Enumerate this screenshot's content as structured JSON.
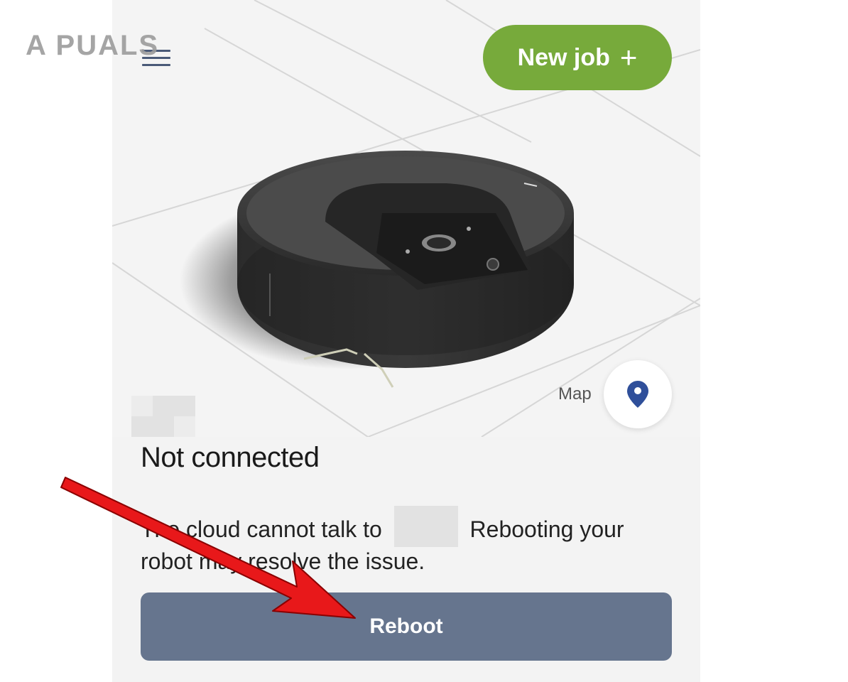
{
  "watermark": {
    "text": "A   PUALS"
  },
  "header": {
    "menu_icon": "hamburger-menu-icon",
    "new_job_label": "New job",
    "new_job_icon": "plus-icon"
  },
  "map": {
    "label": "Map",
    "icon": "location-pin-icon"
  },
  "status": {
    "title": "Not connected",
    "message_part1": "The cloud cannot talk to",
    "message_part2": "Rebooting your robot may resolve the issue."
  },
  "actions": {
    "reboot_label": "Reboot"
  },
  "colors": {
    "accent_green": "#77aa3b",
    "reboot_button": "#66758e",
    "pin_blue": "#2f4f9a",
    "arrow_red": "#e8181a"
  }
}
